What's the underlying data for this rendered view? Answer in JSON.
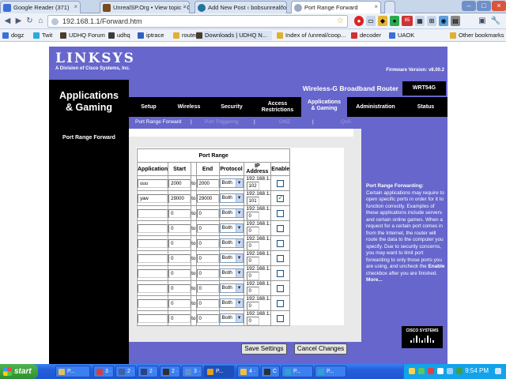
{
  "browser": {
    "tabs": [
      {
        "title": "Google Reader (371)",
        "icon_color": "#3b6fd8"
      },
      {
        "title": "UnrealSP.Org • View topic - C",
        "icon_color": "#7a4a22"
      },
      {
        "title": "Add New Post ‹ bobsunrealco",
        "icon_color": "#21759b"
      },
      {
        "title": "Port Range Forward",
        "icon_color": "#9aa9c4",
        "active": true
      }
    ],
    "address": "192.168.1.1/Forward.htm",
    "bookmarks": [
      {
        "label": "dogz",
        "icon_color": "#3b6fd8"
      },
      {
        "label": "Twit",
        "icon_color": "#2aa9e0"
      },
      {
        "label": "UDHQ Forum",
        "icon_color": "#4b3b2b"
      },
      {
        "label": "udhq",
        "icon_color": "#3b3b3b"
      },
      {
        "label": "iptrace",
        "icon_color": "#3060c0"
      },
      {
        "label": "router",
        "icon_color": "#e0b030"
      },
      {
        "label": "Downloads | UDHQ N...",
        "icon_color": "#4b3b2b"
      },
      {
        "label": "Index of /unreal/coop...",
        "icon_color": "#e0b030"
      },
      {
        "label": "decoder",
        "icon_color": "#cc3333"
      },
      {
        "label": "UAOK",
        "icon_color": "#3b6fd8"
      }
    ],
    "other_bookmarks": "Other bookmarks",
    "ext_badge": "65"
  },
  "router": {
    "logo": "LINKSYS",
    "logo_sub": "A Division of Cisco Systems, Inc.",
    "firmware": "Firmware Version: v8.00.2",
    "section_title": "Applications\n& Gaming",
    "product": "Wireless-G Broadband Router",
    "model": "WRT54G",
    "tabs": [
      "Setup",
      "Wireless",
      "Security",
      "Access\nRestrictions",
      "Applications\n& Gaming",
      "Administration",
      "Status"
    ],
    "subtabs": [
      "Port Range Forward",
      "Port Triggering",
      "DMZ",
      "QoS"
    ],
    "side_title": "Port Range Forward",
    "table": {
      "caption": "Port Range",
      "headers": [
        "Application",
        "Start",
        "",
        "End",
        "Protocol",
        "IP Address",
        "Enable"
      ],
      "to_label": "to",
      "ip_prefix": "192.168.1.",
      "rows": [
        {
          "app": "uuu",
          "start": "2000",
          "end": "2000",
          "protocol": "Both",
          "ip": "102",
          "enabled": false
        },
        {
          "app": "yaw",
          "start": "29000",
          "end": "29000",
          "protocol": "Both",
          "ip": "101",
          "enabled": true
        },
        {
          "app": "",
          "start": "0",
          "end": "0",
          "protocol": "Both",
          "ip": "0",
          "enabled": false
        },
        {
          "app": "",
          "start": "0",
          "end": "0",
          "protocol": "Both",
          "ip": "0",
          "enabled": false
        },
        {
          "app": "",
          "start": "0",
          "end": "0",
          "protocol": "Both",
          "ip": "0",
          "enabled": false
        },
        {
          "app": "",
          "start": "0",
          "end": "0",
          "protocol": "Both",
          "ip": "0",
          "enabled": false
        },
        {
          "app": "",
          "start": "0",
          "end": "0",
          "protocol": "Both",
          "ip": "0",
          "enabled": false
        },
        {
          "app": "",
          "start": "0",
          "end": "0",
          "protocol": "Both",
          "ip": "0",
          "enabled": false
        },
        {
          "app": "",
          "start": "0",
          "end": "0",
          "protocol": "Both",
          "ip": "0",
          "enabled": false
        },
        {
          "app": "",
          "start": "0",
          "end": "0",
          "protocol": "Both",
          "ip": "0",
          "enabled": false
        }
      ]
    },
    "buttons": {
      "save": "Save Settings",
      "cancel": "Cancel Changes"
    },
    "help": {
      "heading": "Port Range Forwarding:",
      "body_1": "Certain applications may require to open specific ports in order for it to function correctly. Examples of these applications include servers and certain online games. When a request for a certain port comes in from the Internet, the router will route the data to the computer you specify. Due to security concerns, you may want to limit port forwarding to only those ports you are using, and uncheck the",
      "enable_word": "Enable",
      "body_2": "checkbox after you are finished.",
      "more": "More..."
    },
    "cisco": "CISCO SYSTEMS"
  },
  "taskbar": {
    "start": "start",
    "buttons": [
      {
        "label": "P...",
        "icon_color": "#e0c060"
      },
      {
        "label": "3 ·",
        "icon_color": "#d04040"
      },
      {
        "label": "2 ·",
        "icon_color": "#4060a0"
      },
      {
        "label": "2 ·",
        "icon_color": "#304080"
      },
      {
        "label": "2 ·",
        "icon_color": "#303030"
      },
      {
        "label": "3 ·",
        "icon_color": "#6090d0"
      },
      {
        "label": "P...",
        "icon_color": "#e0a020",
        "active": true
      },
      {
        "label": "4 ·",
        "icon_color": "#f0c040"
      },
      {
        "label": "C",
        "icon_color": "#303030"
      },
      {
        "label": "P...",
        "icon_color": "#30a0d0"
      },
      {
        "label": "P...",
        "icon_color": "#30a0d0"
      }
    ],
    "clock": "9:54 PM"
  }
}
